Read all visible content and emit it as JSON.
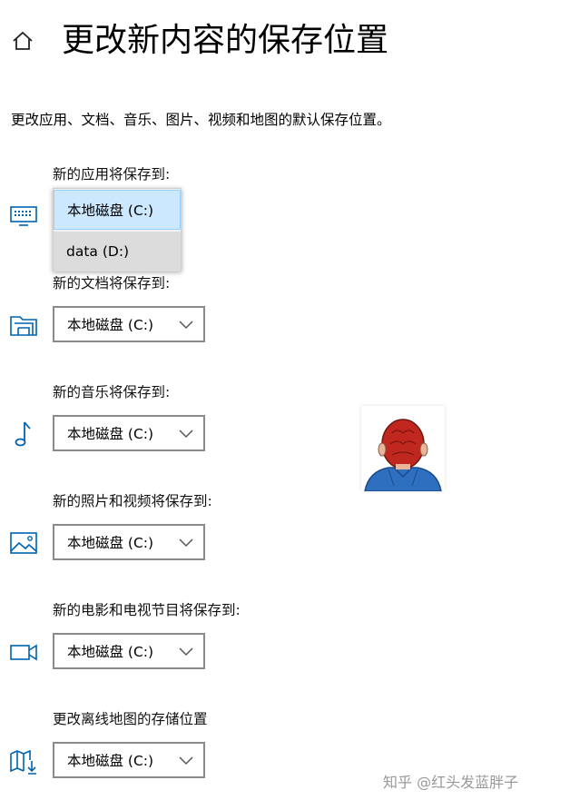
{
  "header": {
    "title": "更改新内容的保存位置"
  },
  "description": "更改应用、文档、音乐、图片、视频和地图的默认保存位置。",
  "sections": [
    {
      "label": "新的应用将保存到:",
      "icon": "monitor-icon",
      "value": "本地磁盘 (C:)"
    },
    {
      "label": "新的文档将保存到:",
      "icon": "folder-icon",
      "value": "本地磁盘 (C:)"
    },
    {
      "label": "新的音乐将保存到:",
      "icon": "music-note-icon",
      "value": "本地磁盘 (C:)"
    },
    {
      "label": "新的照片和视频将保存到:",
      "icon": "picture-icon",
      "value": "本地磁盘 (C:)"
    },
    {
      "label": "新的电影和电视节目将保存到:",
      "icon": "video-camera-icon",
      "value": "本地磁盘 (C:)"
    },
    {
      "label": "更改离线地图的存储位置",
      "icon": "map-download-icon",
      "value": "本地磁盘 (C:)"
    }
  ],
  "popup": {
    "options": [
      "本地磁盘 (C:)",
      "data (D:)"
    ],
    "selected": "本地磁盘 (C:)"
  },
  "watermark": "知乎 @红头发蓝胖子",
  "colors": {
    "icon_blue": "#0063b1",
    "selection": "#cce8ff"
  }
}
